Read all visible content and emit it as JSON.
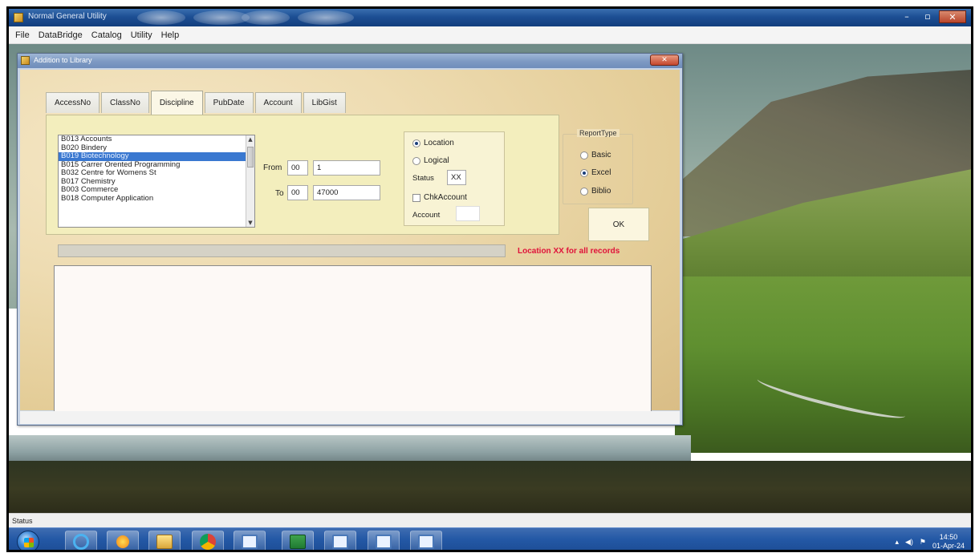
{
  "app": {
    "title": "Normal General Utility",
    "window_controls": {
      "minimize": "–",
      "maximize": "▫",
      "close": "✕"
    }
  },
  "menu": {
    "items": [
      "File",
      "DataBridge",
      "Catalog",
      "Utility",
      "Help"
    ]
  },
  "dialog": {
    "title": "Addition to Library",
    "close": "✕",
    "tabs": [
      "AccessNo",
      "ClassNo",
      "Discipline",
      "PubDate",
      "Account",
      "LibGist"
    ],
    "active_tab": "Discipline",
    "discipline_list": {
      "items": [
        "B013 Accounts",
        "B020 Bindery",
        "B019 Biotechnology",
        "B015 Carrer Orented Programming",
        "B032 Centre for Womens St",
        "B017 Chemistry",
        "B003 Commerce",
        "B018 Computer Application"
      ],
      "selected_index": 2
    },
    "range": {
      "from_label": "From",
      "to_label": "To",
      "from_prefix": "00",
      "from_value": "1",
      "to_prefix": "00",
      "to_value": "47000"
    },
    "location_group": {
      "location_label": "Location",
      "logical_label": "Logical",
      "selected": "Location",
      "status_label": "Status",
      "status_value": "XX",
      "chk_account_label": "ChkAccount",
      "chk_account_checked": false,
      "account_label": "Account",
      "account_value": ""
    },
    "report_type": {
      "legend": "ReportType",
      "options": [
        "Basic",
        "Excel",
        "Biblio"
      ],
      "selected": "Excel"
    },
    "ok_label": "OK",
    "progress": 0,
    "note": "Location XX for all records"
  },
  "status_bar": {
    "label": "Status"
  },
  "taskbar": {
    "apps": [
      "internet-explorer",
      "media-player",
      "file-explorer",
      "chrome",
      "window",
      "excel",
      "window",
      "window",
      "window"
    ],
    "clock_time": "14:50",
    "clock_date": "01-Apr-24"
  }
}
